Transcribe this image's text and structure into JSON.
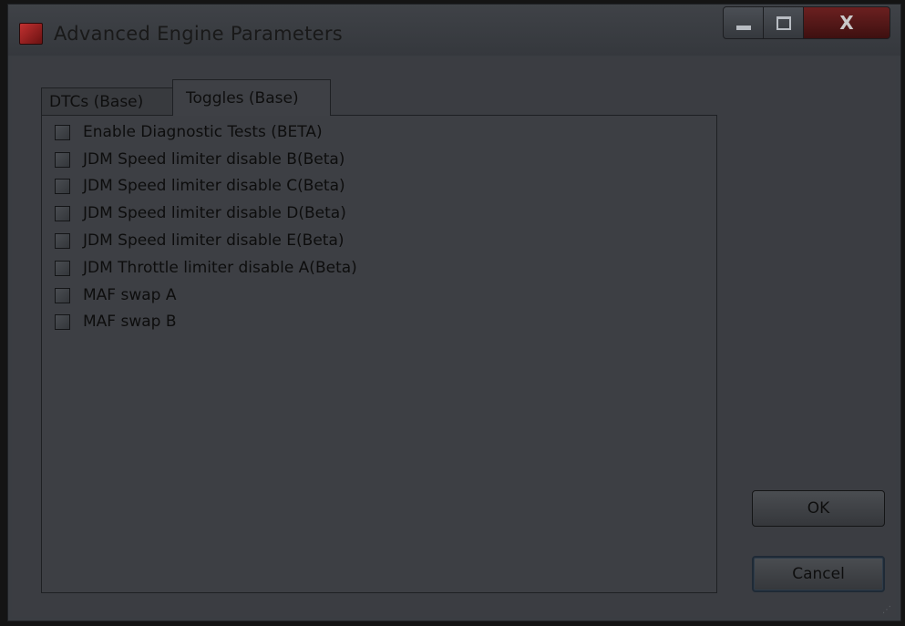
{
  "window": {
    "title": "Advanced Engine Parameters",
    "controls": {
      "close": "X"
    }
  },
  "tabs": [
    {
      "label": "DTCs (Base)",
      "active": false
    },
    {
      "label": "Toggles (Base)",
      "active": true
    }
  ],
  "toggles": [
    {
      "label": "Enable Diagnostic Tests (BETA)",
      "checked": false
    },
    {
      "label": "JDM Speed limiter disable B(Beta)",
      "checked": false
    },
    {
      "label": "JDM Speed limiter disable C(Beta)",
      "checked": false
    },
    {
      "label": "JDM Speed limiter disable D(Beta)",
      "checked": false
    },
    {
      "label": "JDM Speed limiter disable E(Beta)",
      "checked": false
    },
    {
      "label": "JDM Throttle limiter disable A(Beta)",
      "checked": false
    },
    {
      "label": "MAF swap A",
      "checked": false
    },
    {
      "label": "MAF swap B",
      "checked": false
    }
  ],
  "buttons": {
    "ok": "OK",
    "cancel": "Cancel"
  },
  "icons": {
    "app": "app-icon",
    "minimize": "minimize-icon",
    "maximize": "maximize-icon",
    "close": "close-icon",
    "resize": "resize-grip-icon"
  }
}
